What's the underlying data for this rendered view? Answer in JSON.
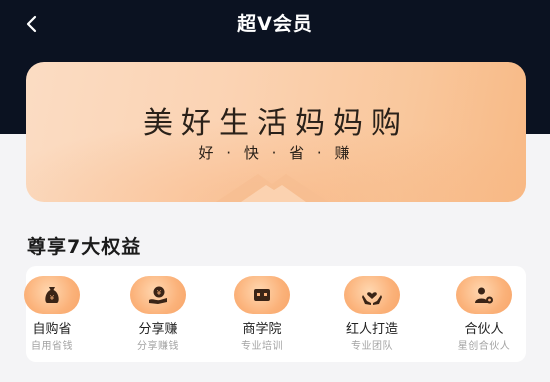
{
  "header": {
    "title": "超V会员"
  },
  "banner": {
    "title": "美好生活妈妈购",
    "subtitle": "好 · 快 · 省 · 赚"
  },
  "benefits_section": {
    "title": "尊享7大权益",
    "items": [
      {
        "label": "自购省",
        "sub": "自用省钱",
        "icon": "money-bag-icon"
      },
      {
        "label": "分享赚",
        "sub": "分享赚钱",
        "icon": "coin-hand-icon"
      },
      {
        "label": "商学院",
        "sub": "专业培训",
        "icon": "ticket-icon"
      },
      {
        "label": "红人打造",
        "sub": "专业团队",
        "icon": "heart-hands-icon"
      },
      {
        "label": "合伙人",
        "sub": "星创合伙人",
        "icon": "partner-icon"
      }
    ]
  },
  "colors": {
    "nav_bg": "#0b1221",
    "banner_gradient_start": "#fbdcc3",
    "banner_gradient_end": "#f8b985",
    "icon_orange": "#f7a467"
  }
}
